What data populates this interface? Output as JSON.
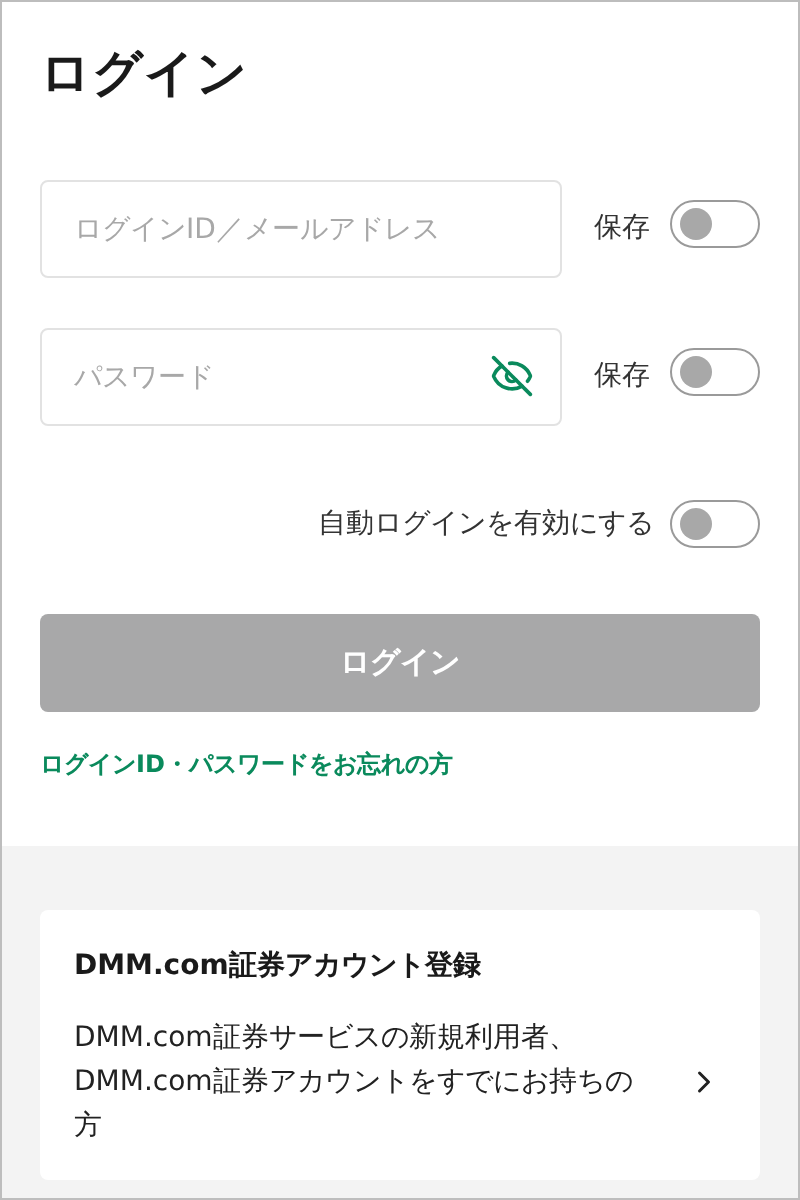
{
  "title": "ログイン",
  "fields": [
    {
      "placeholder": "ログインID／メールアドレス",
      "save_label": "保存",
      "save_on": false,
      "kind": "text"
    },
    {
      "placeholder": "パスワード",
      "save_label": "保存",
      "save_on": false,
      "kind": "password"
    }
  ],
  "auto_login": {
    "label": "自動ログインを有効にする",
    "on": false
  },
  "login_button": {
    "label": "ログイン",
    "disabled": true
  },
  "forgot_link": "ログインID・パスワードをお忘れの方",
  "register_card": {
    "title": "DMM.com証券アカウント登録",
    "description": "DMM.com証券サービスの新規利用者、DMM.com証券アカウントをすでにお持ちの方"
  }
}
